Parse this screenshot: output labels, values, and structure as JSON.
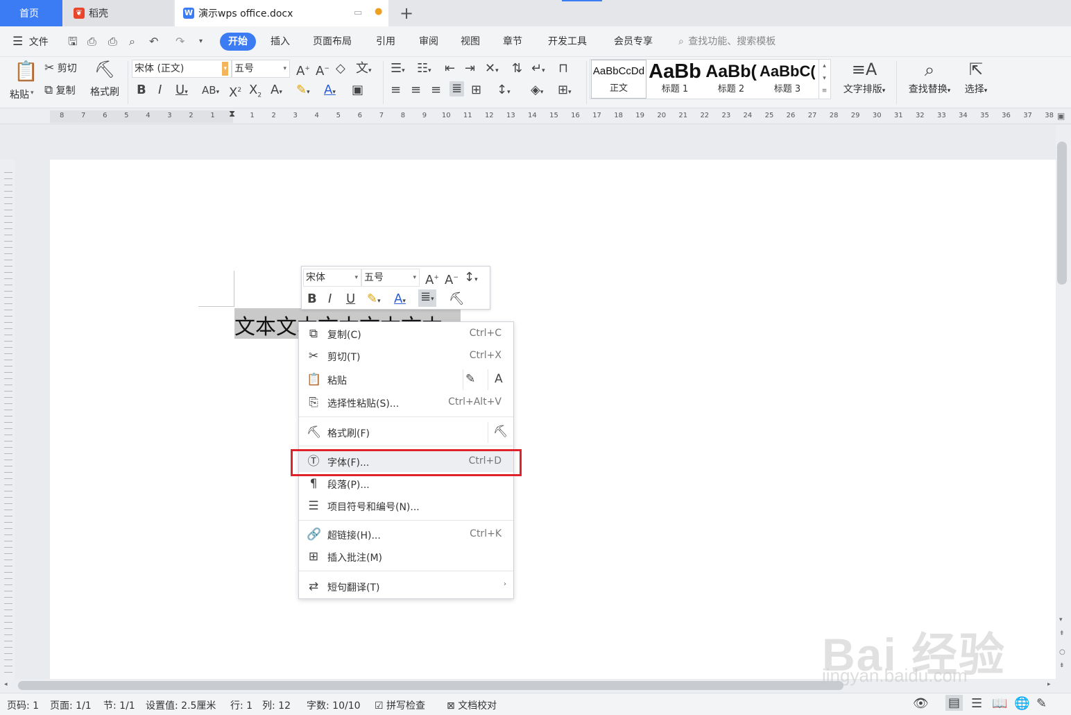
{
  "tabs": {
    "home": "首页",
    "daoke": "稻壳",
    "doc": "演示wps office.docx"
  },
  "menubar": {
    "file": "文件",
    "items": [
      "开始",
      "插入",
      "页面布局",
      "引用",
      "审阅",
      "视图",
      "章节",
      "开发工具",
      "会员专享"
    ],
    "search_placeholder": "查找功能、搜索模板"
  },
  "ribbon": {
    "paste": "粘贴",
    "cut": "剪切",
    "copy": "复制",
    "format_painter": "格式刷",
    "font_name": "宋体 (正文)",
    "font_size": "五号",
    "styles": [
      {
        "sample": "AaBbCcDd",
        "label": "正文"
      },
      {
        "sample": "AaBb",
        "label": "标题 1"
      },
      {
        "sample": "AaBb(",
        "label": "标题 2"
      },
      {
        "sample": "AaBbC(",
        "label": "标题 3"
      }
    ],
    "text_layout": "文字排版",
    "find_replace": "查找替换",
    "select": "选择"
  },
  "ruler_numbers": [
    "8",
    "7",
    "6",
    "5",
    "4",
    "3",
    "2",
    "1",
    "1",
    "2",
    "3",
    "4",
    "5",
    "6",
    "7",
    "8",
    "9",
    "10",
    "11",
    "12",
    "13",
    "14",
    "15",
    "16",
    "17",
    "18",
    "19",
    "20",
    "21",
    "22",
    "23",
    "24",
    "25",
    "26",
    "27",
    "28",
    "29",
    "30",
    "31",
    "32",
    "33",
    "34",
    "35",
    "36",
    "37",
    "38"
  ],
  "document": {
    "text": "文本文本文本文本文本"
  },
  "mini_toolbar": {
    "font": "宋体",
    "size": "五号"
  },
  "context_menu": [
    {
      "label": "复制(C)",
      "shortcut": "Ctrl+C",
      "icon": "copy-icon"
    },
    {
      "label": "剪切(T)",
      "shortcut": "Ctrl+X",
      "icon": "scissors-icon"
    },
    {
      "label": "粘贴",
      "shortcut": "",
      "icon": "paste-icon"
    },
    {
      "label": "选择性粘贴(S)...",
      "shortcut": "Ctrl+Alt+V",
      "icon": "paste-special-icon"
    },
    {
      "label": "格式刷(F)",
      "shortcut": "",
      "icon": "brush-icon"
    },
    {
      "label": "字体(F)...",
      "shortcut": "Ctrl+D",
      "icon": "font-icon"
    },
    {
      "label": "段落(P)...",
      "shortcut": "",
      "icon": "paragraph-icon"
    },
    {
      "label": "项目符号和编号(N)...",
      "shortcut": "",
      "icon": "list-icon"
    },
    {
      "label": "超链接(H)...",
      "shortcut": "Ctrl+K",
      "icon": "link-icon"
    },
    {
      "label": "插入批注(M)",
      "shortcut": "",
      "icon": "comment-icon"
    },
    {
      "label": "短句翻译(T)",
      "shortcut": "",
      "icon": "translate-icon"
    }
  ],
  "status": {
    "page_no": "页码: 1",
    "pages": "页面: 1/1",
    "section": "节: 1/1",
    "setting": "设置值: 2.5厘米",
    "row": "行: 1",
    "col": "列: 12",
    "words": "字数: 10/10",
    "spell": "拼写检查",
    "proof": "文档校对"
  },
  "watermark": {
    "brand": "Bai 经验",
    "url": "jingyan.baidu.com"
  },
  "colors": {
    "accent": "#3b7cf5",
    "highlight_box": "#e0222c",
    "selection": "#c9c9c9"
  }
}
